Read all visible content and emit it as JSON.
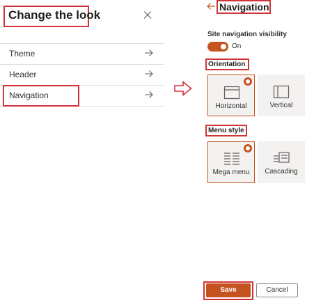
{
  "left_panel": {
    "title": "Change the look",
    "items": [
      {
        "label": "Theme"
      },
      {
        "label": "Header"
      },
      {
        "label": "Navigation"
      }
    ]
  },
  "right_panel": {
    "title": "Navigation",
    "visibility": {
      "label": "Site navigation visibility",
      "state": "On"
    },
    "orientation": {
      "label": "Orientation",
      "options": [
        {
          "label": "Horizontal",
          "selected": true
        },
        {
          "label": "Vertical",
          "selected": false
        }
      ]
    },
    "menu_style": {
      "label": "Menu style",
      "options": [
        {
          "label": "Mega menu",
          "selected": true
        },
        {
          "label": "Cascading",
          "selected": false
        }
      ]
    },
    "buttons": {
      "save": "Save",
      "cancel": "Cancel"
    }
  },
  "colors": {
    "accent": "#c4531f",
    "highlight": "#d13438",
    "option_bg": "#f3f2f1"
  }
}
